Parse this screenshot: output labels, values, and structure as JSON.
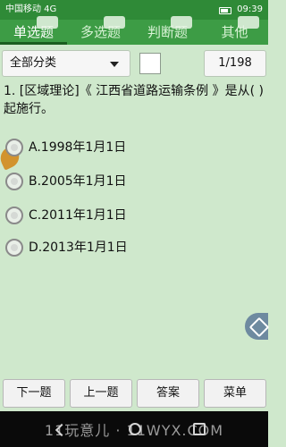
{
  "status_bar": {
    "carrier": "中国移动 4G",
    "time": "09:39"
  },
  "tabs": [
    {
      "label": "单选题",
      "active": true
    },
    {
      "label": "多选题",
      "active": false
    },
    {
      "label": "判断题",
      "active": false
    },
    {
      "label": "其他",
      "active": false
    }
  ],
  "toolbar": {
    "category_label": "全部分类",
    "page_counter": "1/198"
  },
  "question": {
    "text": "1. [区域理论]《 江西省道路运输条例 》是从( )起施行。"
  },
  "options": [
    {
      "label": "A.1998年1月1日"
    },
    {
      "label": "B.2005年1月1日"
    },
    {
      "label": "C.2011年1月1日"
    },
    {
      "label": "D.2013年1月1日"
    }
  ],
  "actions": {
    "next": "下一题",
    "prev": "上一题",
    "answer": "答案",
    "menu": "菜单"
  },
  "watermark": "11玩意儿 · 11WYX.COM",
  "icons": {
    "checkbox": "checkbox-icon",
    "share": "share-icon",
    "leaf": "leaf-icon"
  }
}
